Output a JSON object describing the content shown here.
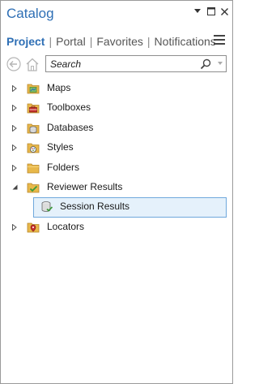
{
  "window": {
    "title": "Catalog",
    "controls": [
      "dropdown-arrow",
      "restore",
      "close"
    ]
  },
  "tabs": [
    {
      "label": "Project",
      "active": true
    },
    {
      "label": "Portal",
      "active": false
    },
    {
      "label": "Favorites",
      "active": false
    },
    {
      "label": "Notifications",
      "active": false
    }
  ],
  "nav": {
    "back_icon": "back-arrow-icon",
    "home_icon": "home-icon"
  },
  "search": {
    "placeholder": "Search",
    "value": ""
  },
  "tree": {
    "items": [
      {
        "label": "Maps",
        "icon": "maps-folder-icon",
        "expanded": false
      },
      {
        "label": "Toolboxes",
        "icon": "toolboxes-folder-icon",
        "expanded": false
      },
      {
        "label": "Databases",
        "icon": "databases-folder-icon",
        "expanded": false
      },
      {
        "label": "Styles",
        "icon": "styles-folder-icon",
        "expanded": false
      },
      {
        "label": "Folders",
        "icon": "folders-icon",
        "expanded": false
      },
      {
        "label": "Reviewer Results",
        "icon": "reviewer-results-icon",
        "expanded": true,
        "children": [
          {
            "label": "Session Results",
            "icon": "session-results-icon",
            "selected": true
          }
        ]
      },
      {
        "label": "Locators",
        "icon": "locators-folder-icon",
        "expanded": false
      }
    ]
  },
  "colors": {
    "accent": "#2e6fb5",
    "selection_bg": "#e5f1fb",
    "selection_border": "#6fa8dc",
    "folder_yellow": "#e8b84a"
  }
}
